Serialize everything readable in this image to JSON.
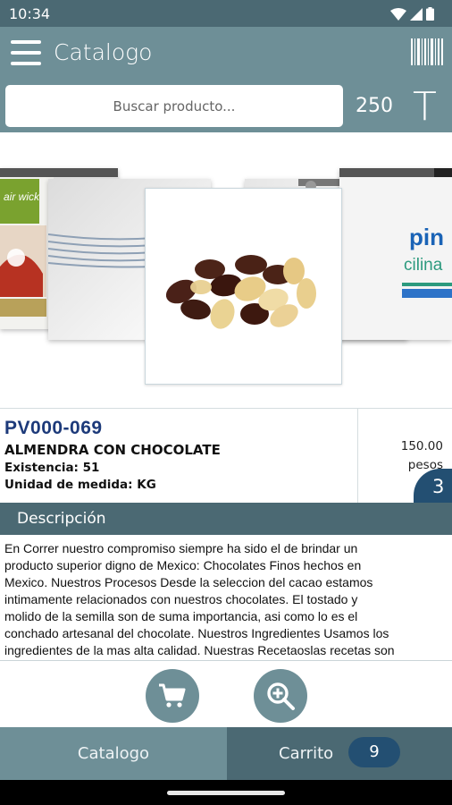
{
  "status_bar": {
    "time": "10:34"
  },
  "app_bar": {
    "title": "Catalogo",
    "menu_icon": "hamburger-menu-icon",
    "barcode_icon": "barcode-icon"
  },
  "search": {
    "placeholder": "Buscar producto...",
    "value": ""
  },
  "toolbar": {
    "count": "250",
    "tool_label": "T"
  },
  "product": {
    "sku": "PV000-069",
    "name": "ALMENDRA CON CHOCOLATE",
    "stock": "Existencia: 51",
    "unit": "Unidad de medida: KG",
    "price": "150.00",
    "currency": "pesos",
    "quantity_badge": "3"
  },
  "carousel": {
    "cards": [
      "air-wick-product-image",
      "rope-product-image",
      "chocolate-almonds-image",
      "box-product-image",
      "medicine-box-image"
    ],
    "partial_text": {
      "air_wick": "air wick",
      "pin": "pin",
      "cilina": "cilina"
    }
  },
  "description": {
    "header": "Descripción",
    "lines": [
      "En Correr nuestro compromiso siempre ha sido el de brindar un",
      "producto superior digno de Mexico: Chocolates Finos hechos en",
      "Mexico. Nuestros Procesos Desde la seleccion del cacao estamos",
      "intimamente relacionados con nuestros chocolates. El tostado y",
      "molido de la semilla son de suma importancia, asi como lo es el",
      "conchado artesanal del chocolate. Nuestros Ingredientes Usamos los",
      "ingredientes de la mas alta calidad. Nuestras Recetaoslas recetas son"
    ]
  },
  "actions": {
    "cart_icon": "shopping-cart-icon",
    "zoom_icon": "zoom-in-icon"
  },
  "bottom_nav": {
    "catalogo_label": "Catalogo",
    "carrito_label": "Carrito",
    "carrito_count": "9"
  },
  "colors": {
    "teal_light": "#6e8f97",
    "teal_dark": "#4b6973",
    "navy": "#234f72",
    "sku_blue": "#1d3a7a"
  }
}
